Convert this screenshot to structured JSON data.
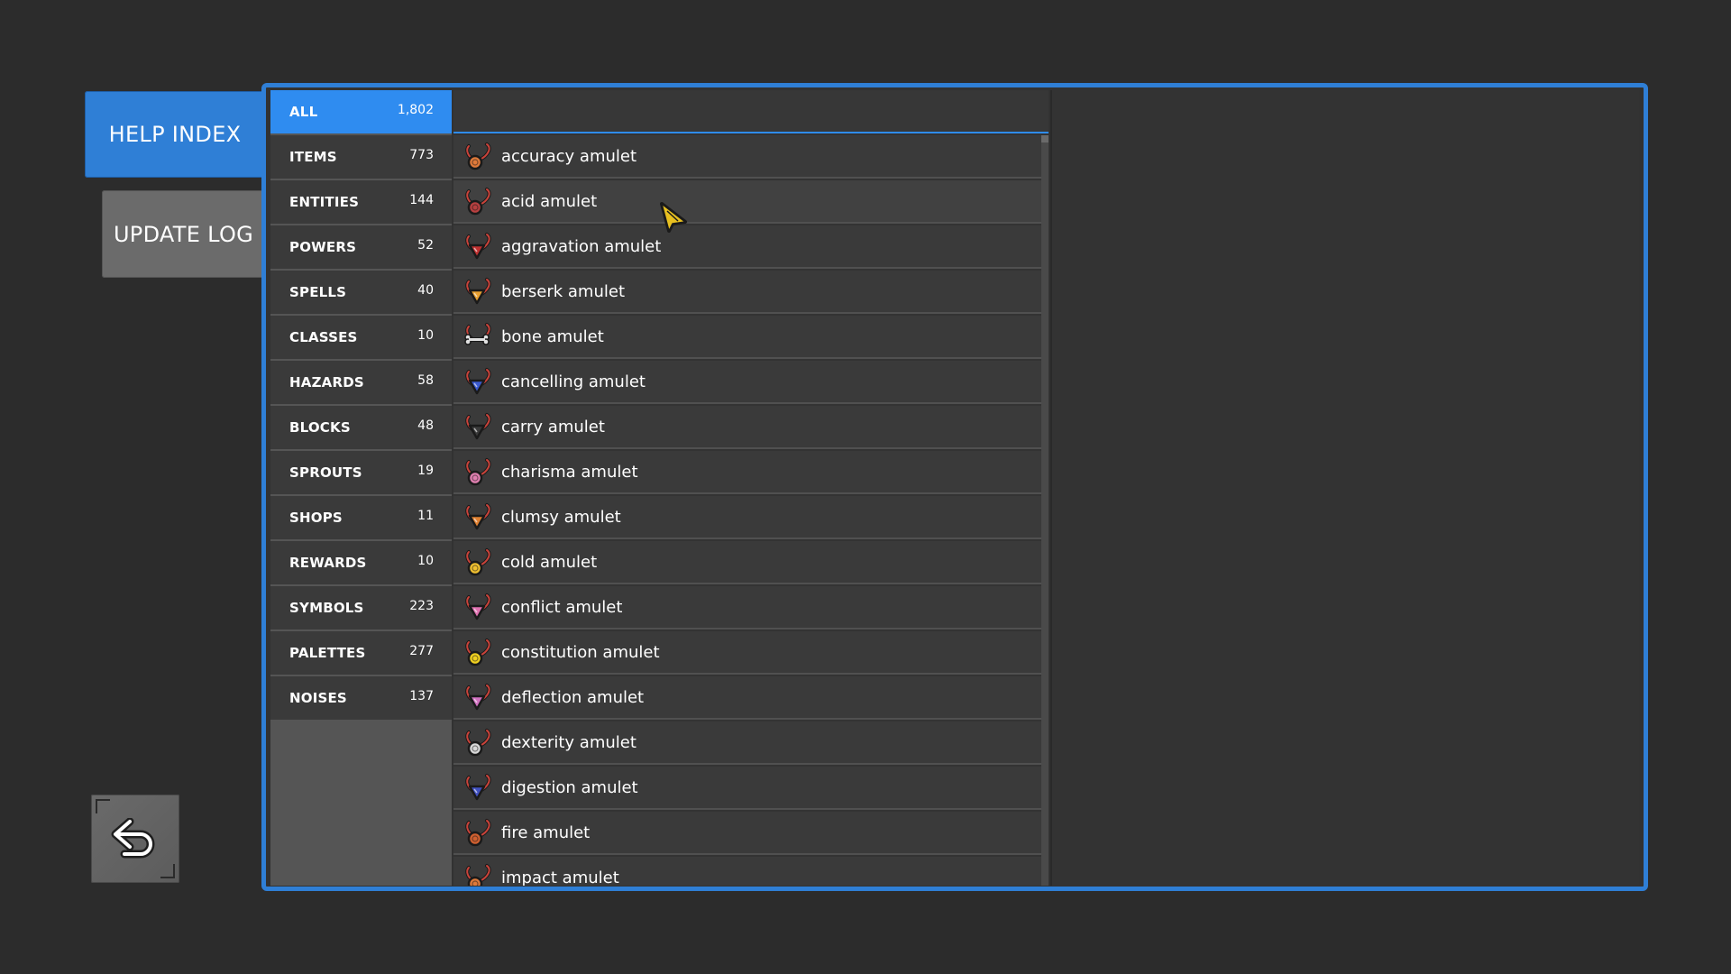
{
  "side_tabs": {
    "help_index": "HELP INDEX",
    "update_log": "UPDATE LOG"
  },
  "categories": [
    {
      "label": "ALL",
      "count": "1,802"
    },
    {
      "label": "ITEMS",
      "count": "773"
    },
    {
      "label": "ENTITIES",
      "count": "144"
    },
    {
      "label": "POWERS",
      "count": "52"
    },
    {
      "label": "SPELLS",
      "count": "40"
    },
    {
      "label": "CLASSES",
      "count": "10"
    },
    {
      "label": "HAZARDS",
      "count": "58"
    },
    {
      "label": "BLOCKS",
      "count": "48"
    },
    {
      "label": "SPROUTS",
      "count": "19"
    },
    {
      "label": "SHOPS",
      "count": "11"
    },
    {
      "label": "REWARDS",
      "count": "10"
    },
    {
      "label": "SYMBOLS",
      "count": "223"
    },
    {
      "label": "PALETTES",
      "count": "277"
    },
    {
      "label": "NOISES",
      "count": "137"
    }
  ],
  "items": [
    {
      "label": "accuracy amulet",
      "icon": "amulet-round-icon",
      "color": "#e07a3a"
    },
    {
      "label": "acid amulet",
      "icon": "amulet-round-icon",
      "color": "#b84040"
    },
    {
      "label": "aggravation amulet",
      "icon": "amulet-triangle-icon",
      "color": "#c03030"
    },
    {
      "label": "berserk amulet",
      "icon": "amulet-triangle-icon",
      "color": "#e8a030"
    },
    {
      "label": "bone amulet",
      "icon": "amulet-bone-icon",
      "color": "#e0e0e0"
    },
    {
      "label": "cancelling amulet",
      "icon": "amulet-triangle-icon",
      "color": "#3a5ad0"
    },
    {
      "label": "carry amulet",
      "icon": "amulet-triangle-icon",
      "color": "#3a3a3a"
    },
    {
      "label": "charisma amulet",
      "icon": "amulet-round-icon",
      "color": "#e080b0"
    },
    {
      "label": "clumsy amulet",
      "icon": "amulet-triangle-icon",
      "color": "#e08030"
    },
    {
      "label": "cold amulet",
      "icon": "amulet-round-icon",
      "color": "#f0c030"
    },
    {
      "label": "conflict amulet",
      "icon": "amulet-triangle-icon",
      "color": "#e070b0"
    },
    {
      "label": "constitution amulet",
      "icon": "amulet-round-icon",
      "color": "#f0d020"
    },
    {
      "label": "deflection amulet",
      "icon": "amulet-triangle-icon",
      "color": "#d070c0"
    },
    {
      "label": "dexterity amulet",
      "icon": "amulet-round-icon",
      "color": "#d8d8d8"
    },
    {
      "label": "digestion amulet",
      "icon": "amulet-triangle-icon",
      "color": "#4050c0"
    },
    {
      "label": "fire amulet",
      "icon": "amulet-round-icon",
      "color": "#d06030"
    },
    {
      "label": "impact amulet",
      "icon": "amulet-round-icon",
      "color": "#e07a3a"
    }
  ],
  "back_button_icon": "undo-arrow-icon",
  "colors": {
    "accent": "#2f7fd6",
    "active_category": "#2f8cf0",
    "background": "#2c2c2c"
  }
}
